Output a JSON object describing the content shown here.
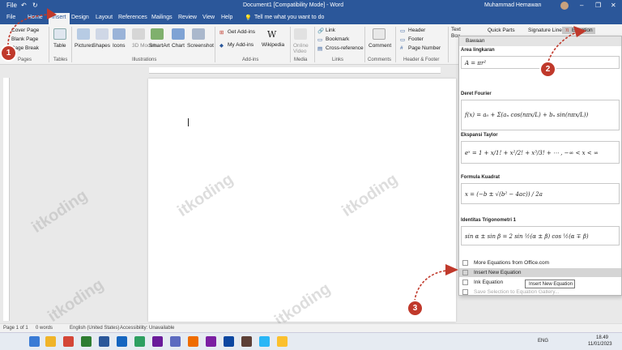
{
  "titlebar": {
    "qat_file": "File",
    "doc_title": "Document1 [Compatibility Mode]  -  Word",
    "user": "Muhammad Hemawan"
  },
  "tabs": [
    "File",
    "Home",
    "Insert",
    "Design",
    "Layout",
    "References",
    "Mailings",
    "Review",
    "View",
    "Help"
  ],
  "tell_me": "Tell me what you want to do",
  "ribbon": {
    "pages": {
      "cover": "Cover Page",
      "blank": "Blank Page",
      "break": "Page Break",
      "group": "Pages"
    },
    "tables": {
      "table": "Table",
      "group": "Tables"
    },
    "illustrations": {
      "pictures": "Pictures",
      "shapes": "Shapes",
      "icons": "Icons",
      "models": "3D Models",
      "smartart": "SmartArt",
      "chart": "Chart",
      "screenshot": "Screenshot",
      "group": "Illustrations"
    },
    "addins": {
      "get": "Get Add-ins",
      "my": "My Add-ins",
      "wiki": "Wikipedia",
      "group": "Add-ins"
    },
    "media": {
      "video": "Online Video",
      "group": "Media"
    },
    "links": {
      "link": "Link",
      "bookmark": "Bookmark",
      "cross": "Cross-reference",
      "group": "Links"
    },
    "comments": {
      "comment": "Comment",
      "group": "Comments"
    },
    "hf": {
      "header": "Header",
      "footer": "Footer",
      "pn": "Page Number",
      "group": "Header & Footer"
    },
    "text": {
      "box": "Text Box",
      "quick": "Quick Parts",
      "sig": "Signature Line",
      "eq": "Equation"
    }
  },
  "dropdown": {
    "header": "Bawaan",
    "items": [
      {
        "title": "Area lingkaran",
        "eq": "A = πr²"
      },
      {
        "title": "Deret Fourier",
        "eq": "f(x) = a₀ + Σ(aₙ cos(nπx/L) + bₙ sin(nπx/L))"
      },
      {
        "title": "Ekspansi Taylor",
        "eq": "eˣ = 1 + x/1! + x²/2! + x³/3! + ⋯ ,   −∞ < x < ∞"
      },
      {
        "title": "Formula Kuadrat",
        "eq": "x = (−b ± √(b² − 4ac)) / 2a"
      },
      {
        "title": "Identitas Trigonometri 1",
        "eq": "sin α ± sin β = 2 sin ½(α ± β) cos ½(α ∓ β)"
      }
    ],
    "menu": [
      "More Equations from Office.com",
      "Insert New Equation",
      "Ink Equation",
      "Save Selection to Equation Gallery..."
    ]
  },
  "tooltip": "Insert New Equation",
  "badges": [
    "1",
    "2",
    "3"
  ],
  "watermark": "itkoding",
  "status": {
    "page": "Page 1 of 1",
    "words": "0 words",
    "lang": "English (United States)",
    "access": "Accessibility: Unavailable"
  },
  "taskbar": {
    "lang": "ENG",
    "time": "18.49",
    "date": "11/01/2023"
  }
}
